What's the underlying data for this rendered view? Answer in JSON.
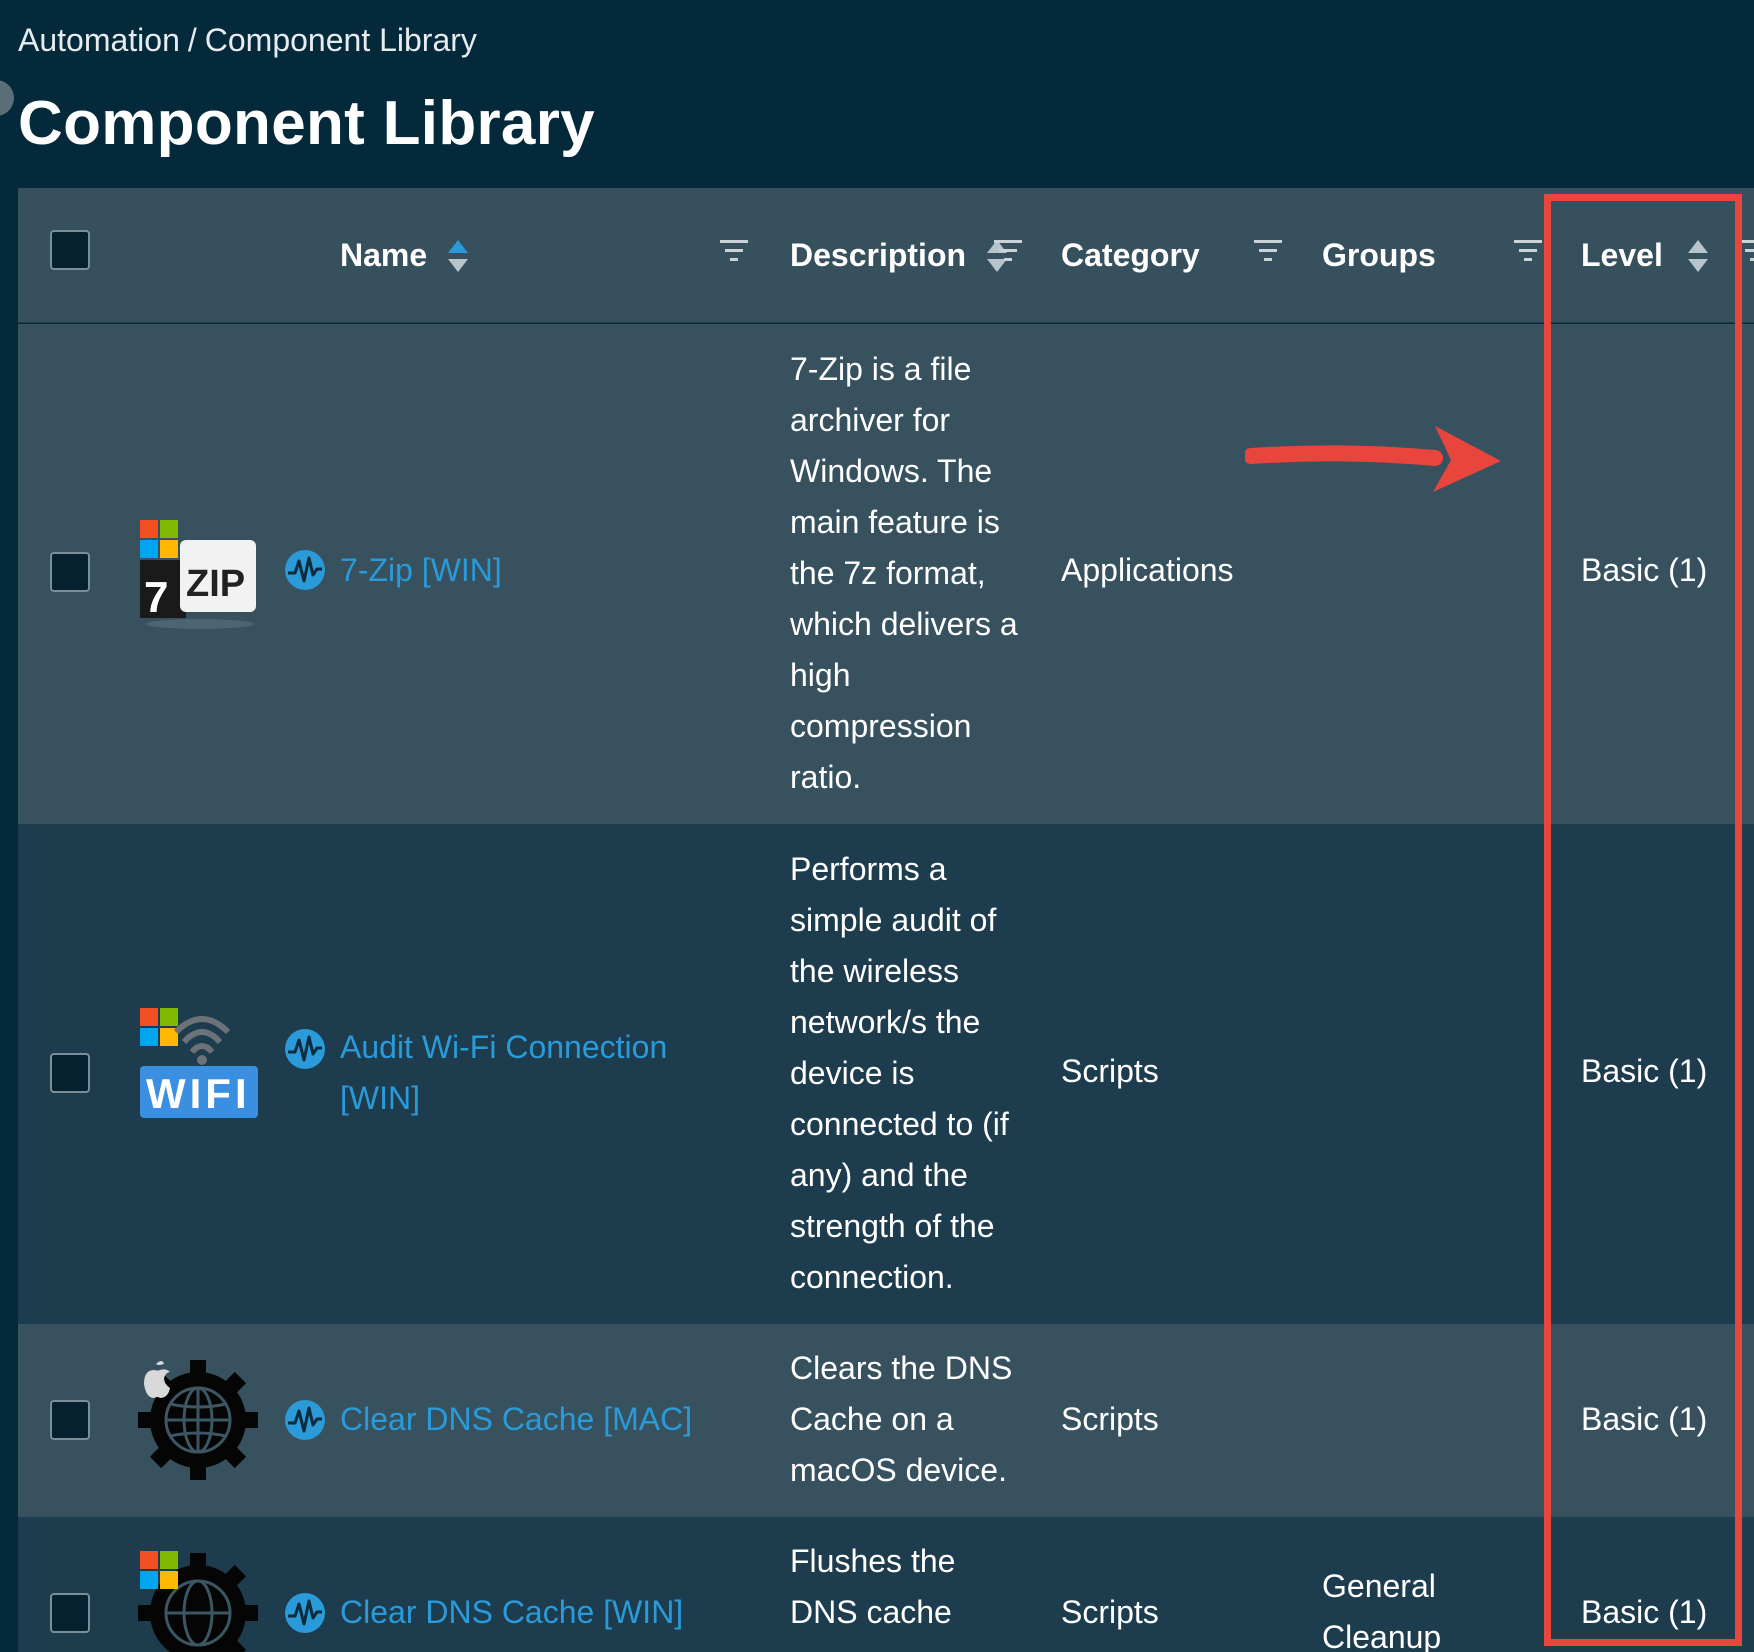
{
  "breadcrumb": {
    "parent": "Automation",
    "separator": "/",
    "current": "Component Library"
  },
  "page_title": "Component Library",
  "table": {
    "columns": {
      "name": "Name",
      "description": "Description",
      "category": "Category",
      "groups": "Groups",
      "level": "Level"
    },
    "rows": [
      {
        "name": "7-Zip [WIN]",
        "description": [
          "7-Zip is a file",
          "archiver for",
          "Windows. The",
          "main feature is",
          "the 7z format,",
          "which delivers a",
          "high",
          "compression",
          "ratio."
        ],
        "category": "Applications",
        "groups": "",
        "level": "Basic (1)",
        "logo": "7zip-windows-logo"
      },
      {
        "name": [
          "Audit Wi-Fi Connection",
          "[WIN]"
        ],
        "description": [
          "Performs a",
          "simple audit of",
          "the wireless",
          "network/s the",
          "device is",
          "connected to (if",
          "any) and the",
          "strength of the",
          "connection."
        ],
        "category": "Scripts",
        "groups": "",
        "level": "Basic (1)",
        "logo": "wifi-windows-logo"
      },
      {
        "name": "Clear DNS Cache [MAC]",
        "description": [
          "Clears the DNS",
          "Cache on a",
          "macOS device."
        ],
        "category": "Scripts",
        "groups": "",
        "level": "Basic (1)",
        "logo": "globe-gear-apple-logo"
      },
      {
        "name": "Clear DNS Cache [WIN]",
        "description": [
          "Flushes the",
          "DNS cache"
        ],
        "category": "Scripts",
        "groups": [
          "General",
          "Cleanup"
        ],
        "level": "Basic (1)",
        "logo": "globe-gear-windows-logo"
      }
    ]
  },
  "colors": {
    "background": "#03293a",
    "header": "#37505e",
    "row_light": "#37515f",
    "row_dark": "#1d3c4e",
    "link": "#2a9ad8",
    "annotation": "#e8453c"
  }
}
